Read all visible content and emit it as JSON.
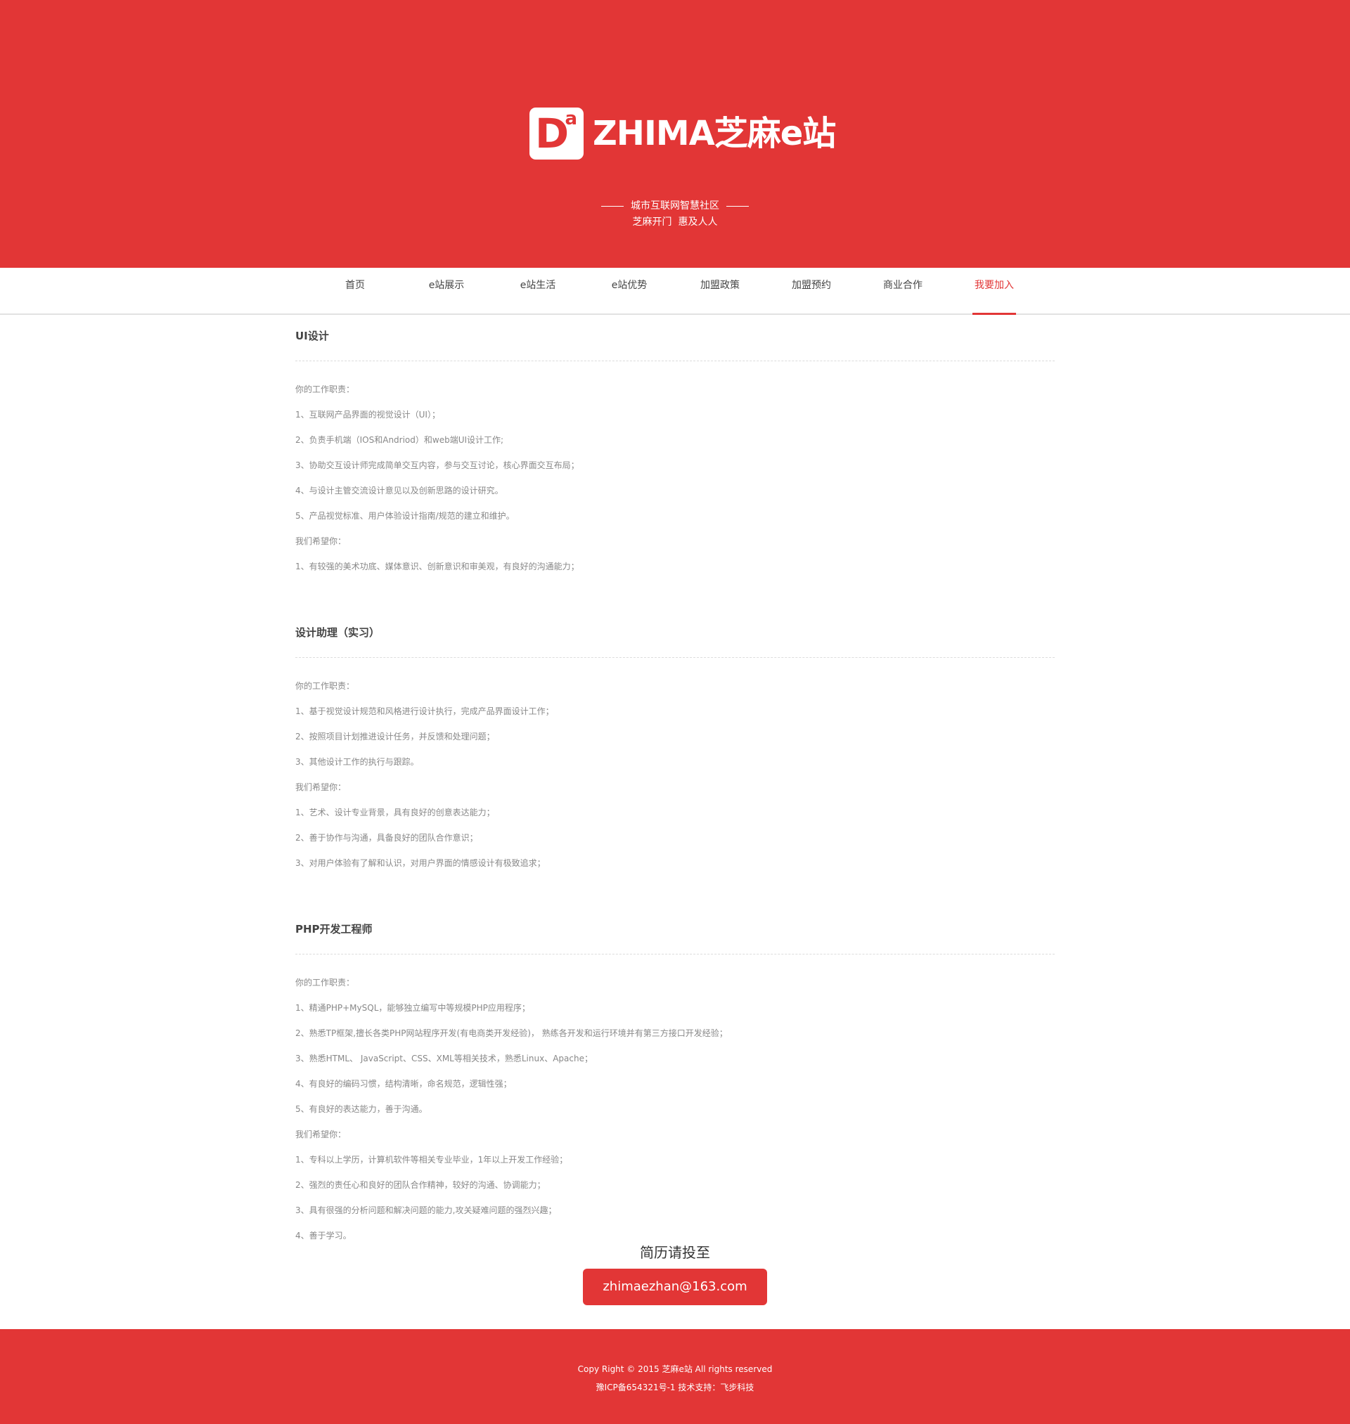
{
  "header": {
    "logo_mark": "D",
    "logo_mark_sup": "a",
    "logo_text": "ZHIMA芝麻e站",
    "tagline_1": "城市互联网智慧社区",
    "tagline_2": "芝麻开门  惠及人人"
  },
  "nav": {
    "items": [
      {
        "label": "首页"
      },
      {
        "label": "e站展示"
      },
      {
        "label": "e站生活"
      },
      {
        "label": "e站优势"
      },
      {
        "label": "加盟政策"
      },
      {
        "label": "加盟预约"
      },
      {
        "label": "商业合作"
      },
      {
        "label": "我要加入"
      }
    ],
    "active_index": 7
  },
  "jobs": [
    {
      "title": "UI设计",
      "lines": [
        "你的工作职责：",
        "1、互联网产品界面的视觉设计（UI）；",
        "2、负责手机端（IOS和Andriod）和web端UI设计工作;",
        "3、协助交互设计师完成简单交互内容，参与交互讨论，核心界面交互布局；",
        "4、与设计主管交流设计意见以及创新思路的设计研究。",
        "5、产品视觉标准、用户体验设计指南/规范的建立和维护。",
        "我们希望你：",
        "1、有较强的美术功底、媒体意识、创新意识和审美观，有良好的沟通能力；"
      ]
    },
    {
      "title": "设计助理（实习）",
      "lines": [
        "你的工作职责：",
        "1、基于视觉设计规范和风格进行设计执行，完成产品界面设计工作；",
        "2、按照项目计划推进设计任务，并反馈和处理问题；",
        "3、其他设计工作的执行与跟踪。",
        "我们希望你：",
        "1、艺术、设计专业背景，具有良好的创意表达能力；",
        "2、善于协作与沟通，具备良好的团队合作意识；",
        "3、对用户体验有了解和认识，对用户界面的情感设计有极致追求；"
      ]
    },
    {
      "title": "PHP开发工程师",
      "lines": [
        "你的工作职责：",
        "1、精通PHP+MySQL，能够独立编写中等规模PHP应用程序；",
        "2、熟悉TP框架,擅长各类PHP网站程序开发(有电商类开发经验)， 熟练各开发和运行环境并有第三方接口开发经验；",
        "3、熟悉HTML、 JavaScript、CSS、XML等相关技术，熟悉Linux、Apache；",
        "4、有良好的编码习惯，结构清晰，命名规范，逻辑性强；",
        "5、有良好的表达能力，善于沟通。",
        "我们希望你：",
        "1、专科以上学历，计算机软件等相关专业毕业，1年以上开发工作经验；",
        "2、强烈的责任心和良好的团队合作精神，较好的沟通、协调能力；",
        "3、具有很强的分析问题和解决问题的能力,攻关疑难问题的强烈兴趣；",
        "4、善于学习。"
      ]
    }
  ],
  "resume": {
    "title": "简历请投至",
    "email": "zhimaezhan@163.com"
  },
  "footer": {
    "copyright": "Copy Right © 2015 芝麻e站 All rights reserved",
    "icp": "豫ICP备654321号-1 技术支持：飞步科技"
  },
  "colors": {
    "brand_red": "#e23636",
    "nav_active": "#e23636",
    "body_text": "#888888"
  }
}
